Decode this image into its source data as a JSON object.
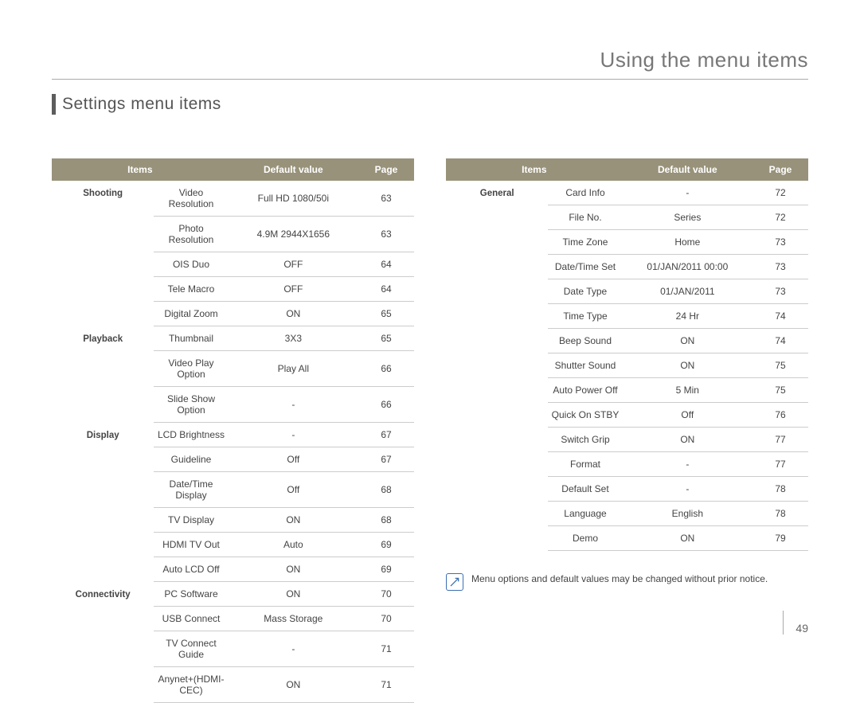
{
  "page_title": "Using the menu items",
  "section_title": "Settings menu items",
  "headers": {
    "items": "Items",
    "default": "Default value",
    "page": "Page"
  },
  "left_table": [
    {
      "category": "Shooting",
      "item": "Video Resolution",
      "default": "Full HD  1080/50i",
      "page": "63"
    },
    {
      "category": "",
      "item": "Photo Resolution",
      "default": "4.9M  2944X1656",
      "page": "63"
    },
    {
      "category": "",
      "item": "OIS Duo",
      "default": "OFF",
      "page": "64"
    },
    {
      "category": "",
      "item": "Tele Macro",
      "default": "OFF",
      "page": "64"
    },
    {
      "category": "",
      "item": "Digital Zoom",
      "default": "ON",
      "page": "65"
    },
    {
      "category": "Playback",
      "item": "Thumbnail",
      "default": "3X3",
      "page": "65"
    },
    {
      "category": "",
      "item": "Video Play Option",
      "default": "Play All",
      "page": "66"
    },
    {
      "category": "",
      "item": "Slide Show Option",
      "default": "-",
      "page": "66"
    },
    {
      "category": "Display",
      "item": "LCD Brightness",
      "default": "-",
      "page": "67"
    },
    {
      "category": "",
      "item": "Guideline",
      "default": "Off",
      "page": "67"
    },
    {
      "category": "",
      "item": "Date/Time Display",
      "default": "Off",
      "page": "68"
    },
    {
      "category": "",
      "item": "TV Display",
      "default": "ON",
      "page": "68"
    },
    {
      "category": "",
      "item": "HDMI TV Out",
      "default": "Auto",
      "page": "69"
    },
    {
      "category": "",
      "item": "Auto LCD Off",
      "default": "ON",
      "page": "69"
    },
    {
      "category": "Connectivity",
      "item": "PC Software",
      "default": "ON",
      "page": "70"
    },
    {
      "category": "",
      "item": "USB Connect",
      "default": "Mass Storage",
      "page": "70"
    },
    {
      "category": "",
      "item": "TV Connect Guide",
      "default": "-",
      "page": "71"
    },
    {
      "category": "",
      "item": "Anynet+(HDMI-CEC)",
      "default": "ON",
      "page": "71"
    }
  ],
  "right_table": [
    {
      "category": "General",
      "item": "Card Info",
      "default": "-",
      "page": "72"
    },
    {
      "category": "",
      "item": "File No.",
      "default": "Series",
      "page": "72"
    },
    {
      "category": "",
      "item": "Time Zone",
      "default": "Home",
      "page": "73"
    },
    {
      "category": "",
      "item": "Date/Time Set",
      "default": "01/JAN/2011 00:00",
      "page": "73"
    },
    {
      "category": "",
      "item": "Date Type",
      "default": "01/JAN/2011",
      "page": "73"
    },
    {
      "category": "",
      "item": "Time Type",
      "default": "24 Hr",
      "page": "74"
    },
    {
      "category": "",
      "item": "Beep Sound",
      "default": "ON",
      "page": "74"
    },
    {
      "category": "",
      "item": "Shutter Sound",
      "default": "ON",
      "page": "75"
    },
    {
      "category": "",
      "item": "Auto Power Off",
      "default": "5 Min",
      "page": "75"
    },
    {
      "category": "",
      "item": "Quick On STBY",
      "default": "Off",
      "page": "76"
    },
    {
      "category": "",
      "item": "Switch Grip",
      "default": "ON",
      "page": "77"
    },
    {
      "category": "",
      "item": "Format",
      "default": "-",
      "page": "77"
    },
    {
      "category": "",
      "item": "Default Set",
      "default": "-",
      "page": "78"
    },
    {
      "category": "",
      "item": "Language",
      "default": "English",
      "page": "78"
    },
    {
      "category": "",
      "item": "Demo",
      "default": "ON",
      "page": "79"
    }
  ],
  "notice": "Menu options and default values may be changed without prior notice.",
  "page_number": "49"
}
